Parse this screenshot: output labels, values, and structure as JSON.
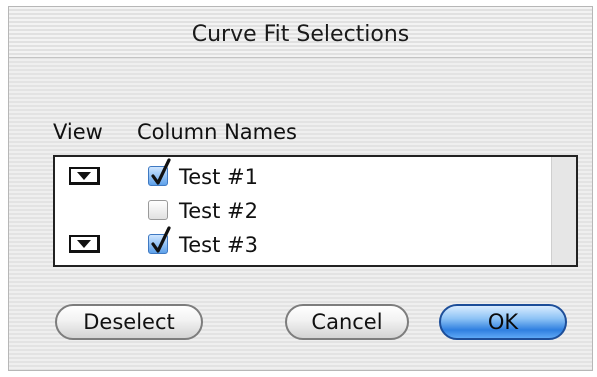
{
  "dialog": {
    "title": "Curve Fit Selections"
  },
  "headers": {
    "view": "View",
    "column_names": "Column Names"
  },
  "rows": [
    {
      "label": "Test #1",
      "checked": true,
      "has_view_popup": true
    },
    {
      "label": "Test #2",
      "checked": false,
      "has_view_popup": false
    },
    {
      "label": "Test #3",
      "checked": true,
      "has_view_popup": true
    }
  ],
  "buttons": {
    "deselect": "Deselect",
    "cancel": "Cancel",
    "ok": "OK"
  },
  "colors": {
    "accent": "#3f79c2",
    "default_button": "#2f7fe0"
  }
}
